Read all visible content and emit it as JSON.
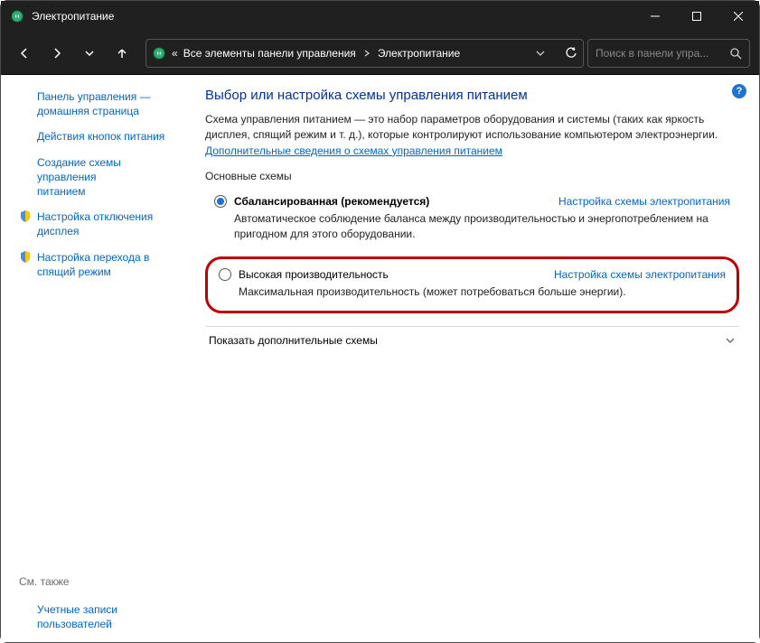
{
  "window": {
    "title": "Электропитание"
  },
  "breadcrumb": {
    "prefix": "«",
    "part1": "Все элементы панели управления",
    "part2": "Электропитание"
  },
  "search": {
    "placeholder": "Поиск в панели упра..."
  },
  "sidebar": {
    "home1": "Панель управления —",
    "home2": "домашняя страница",
    "l1": "Действия кнопок питания",
    "l2a": "Создание схемы управления",
    "l2b": "питанием",
    "l3a": "Настройка отключения",
    "l3b": "дисплея",
    "l4a": "Настройка перехода в",
    "l4b": "спящий режим",
    "seealso": "См. также",
    "accounts1": "Учетные записи",
    "accounts2": "пользователей"
  },
  "main": {
    "title": "Выбор или настройка схемы управления питанием",
    "desc": "Схема управления питанием — это набор параметров оборудования и системы (таких как яркость дисплея, спящий режим и т. д.), которые контролируют использование компьютером электроэнергии. ",
    "desc_link": "Дополнительные сведения о схемах управления питанием",
    "section": "Основные схемы",
    "plan1": {
      "name": "Сбалансированная (рекомендуется)",
      "link": "Настройка схемы электропитания",
      "desc": "Автоматическое соблюдение баланса между производительностью и энергопотреблением на пригодном для этого оборудовании."
    },
    "plan2": {
      "name": "Высокая производительность",
      "link": "Настройка схемы электропитания",
      "desc": "Максимальная производительность (может потребоваться больше энергии)."
    },
    "expander": "Показать дополнительные схемы"
  }
}
